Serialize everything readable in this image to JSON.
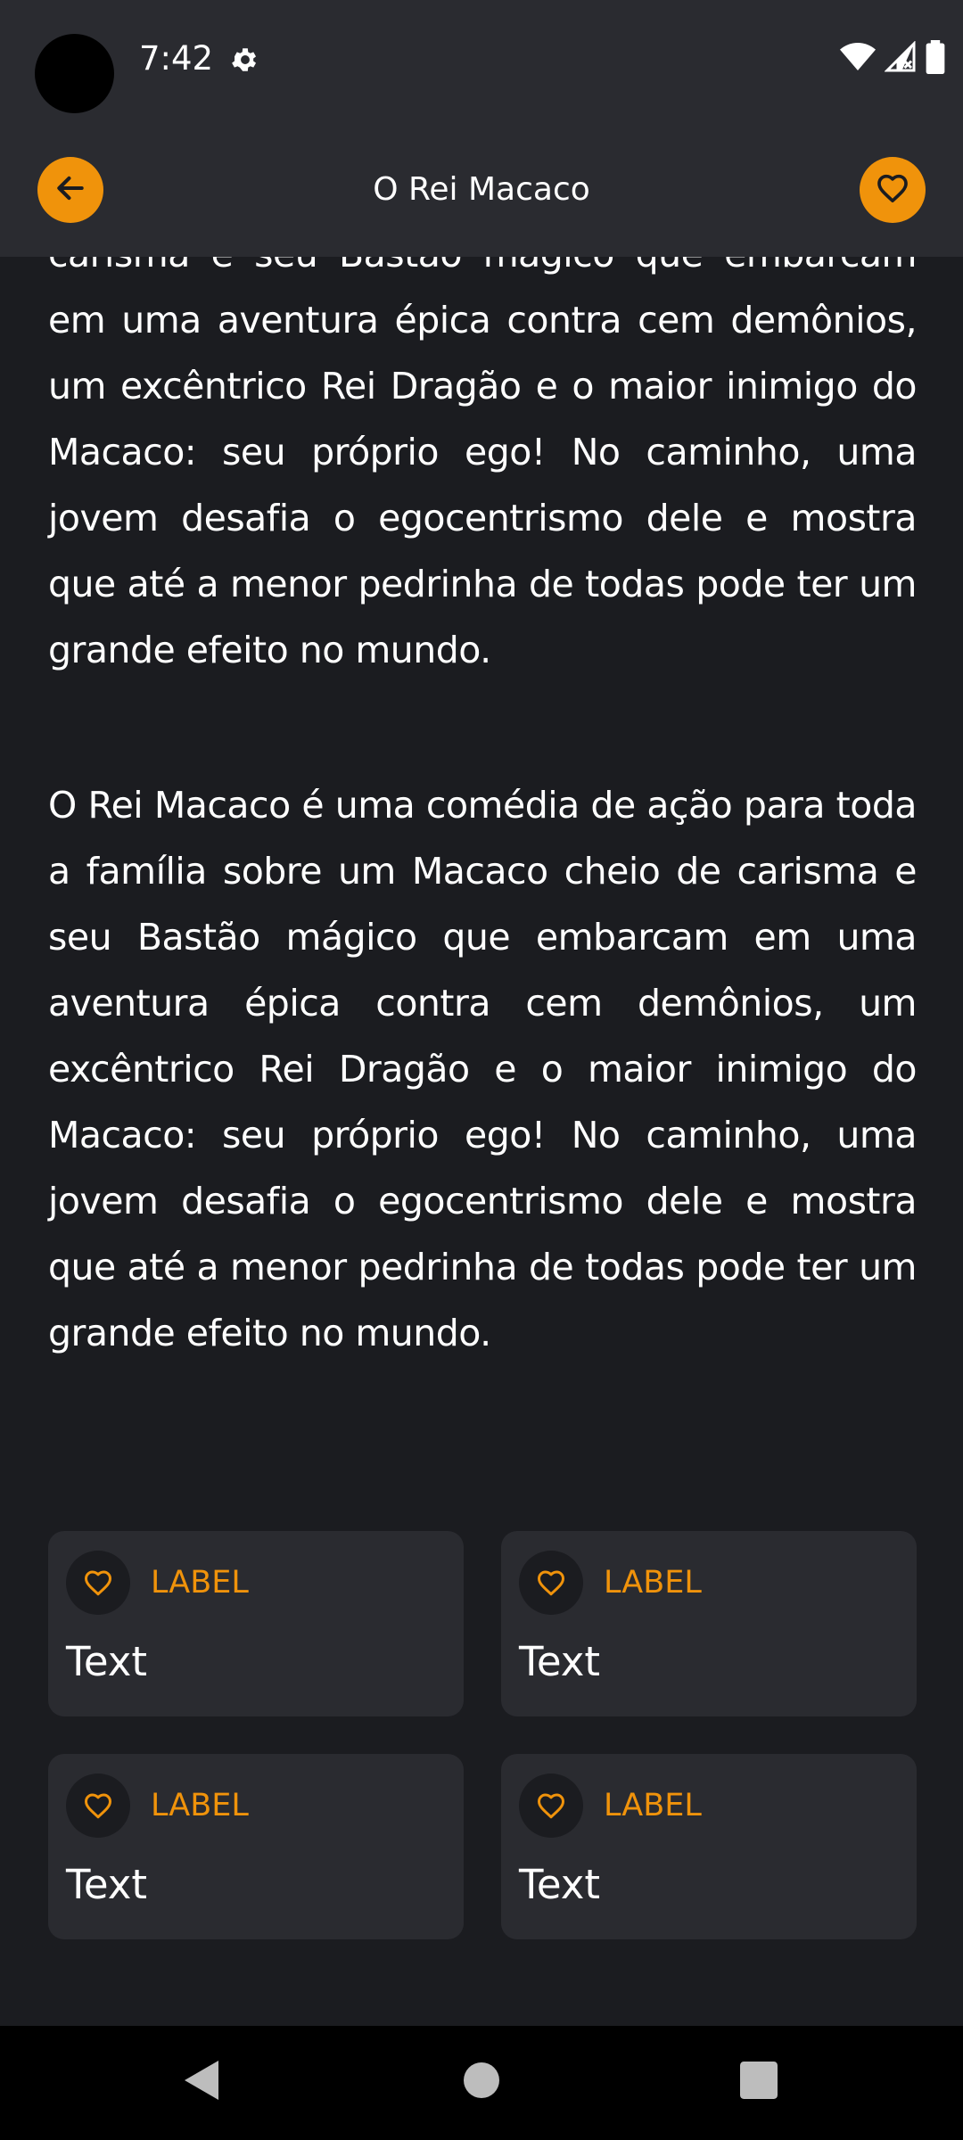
{
  "status_bar": {
    "time": "7:42",
    "icons": [
      "settings-gear-icon",
      "wifi-icon",
      "signal-icon",
      "battery-icon"
    ]
  },
  "top_bar": {
    "title": "O Rei Macaco",
    "back_icon": "arrow-left-icon",
    "favorite_icon": "heart-outline-icon"
  },
  "description": {
    "partial_paragraph": "carisma e seu Bastão mágico que embarcam em uma aventura épica contra cem demônios, um excêntrico Rei Dragão e o maior inimigo do Macaco: seu próprio ego! No caminho, uma jovem desafia o egocentrismo dele e mostra que até a menor pedrinha de todas pode ter um grande efeito no mundo.",
    "full_paragraph": "O Rei Macaco é uma comédia de ação para toda a família sobre um Macaco cheio de carisma e seu Bastão mágico que embarcam em uma aventura épica contra cem demônios, um excêntrico Rei Dragão e o maior inimigo do Macaco: seu próprio ego! No caminho, uma jovem desafia o egocentrismo dele e mostra que até a menor pedrinha de todas pode ter um grande efeito no mundo."
  },
  "info_cards": [
    {
      "label": "LABEL",
      "text": "Text",
      "icon": "heart-outline-icon"
    },
    {
      "label": "LABEL",
      "text": "Text",
      "icon": "heart-outline-icon"
    },
    {
      "label": "LABEL",
      "text": "Text",
      "icon": "heart-outline-icon"
    },
    {
      "label": "LABEL",
      "text": "Text",
      "icon": "heart-outline-icon"
    }
  ],
  "nav_bar": {
    "buttons": [
      "nav-back-icon",
      "nav-home-icon",
      "nav-recents-icon"
    ]
  },
  "colors": {
    "accent": "#f0930b",
    "background": "#1b1c20",
    "surface": "#2a2b30",
    "text": "#ffffff"
  }
}
